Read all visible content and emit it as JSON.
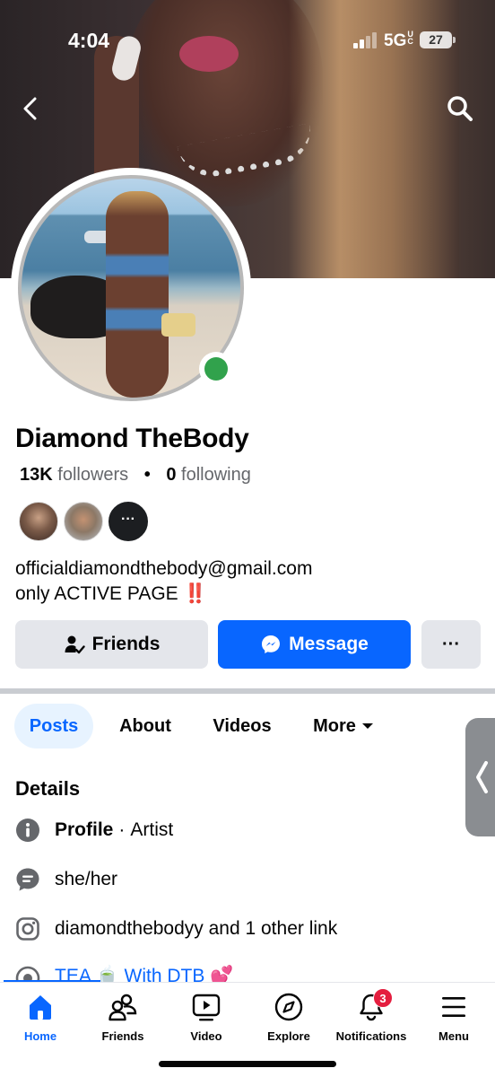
{
  "status_bar": {
    "time": "4:04",
    "network": "5G",
    "network_suffix": "UC",
    "battery": "27"
  },
  "profile": {
    "name": "Diamond TheBody",
    "followers_count": "13K",
    "followers_label": "followers",
    "separator": "•",
    "following_count": "0",
    "following_label": "following",
    "mutuals_more": "···",
    "bio_line1": "officialdiamondthebody@gmail.com",
    "bio_line2": "only ACTIVE PAGE",
    "bio_emoji": "‼️"
  },
  "actions": {
    "friends": "Friends",
    "message": "Message",
    "more": "···"
  },
  "tabs": [
    {
      "label": "Posts"
    },
    {
      "label": "About"
    },
    {
      "label": "Videos"
    },
    {
      "label": "More"
    }
  ],
  "details": {
    "title": "Details",
    "profile_label": "Profile",
    "profile_sep": "·",
    "profile_category": "Artist",
    "pronouns": "she/her",
    "links": "diamondthebodyy and 1 other link",
    "partial_row": "TEA 🍵 With DTB 💕"
  },
  "bottom_nav": {
    "items": [
      {
        "label": "Home"
      },
      {
        "label": "Friends"
      },
      {
        "label": "Video"
      },
      {
        "label": "Explore"
      },
      {
        "label": "Notifications"
      },
      {
        "label": "Menu"
      }
    ],
    "notification_count": "3"
  },
  "colors": {
    "accent": "#0866ff",
    "online": "#31a24c",
    "badge": "#e41e3f",
    "button_gray": "#e4e6eb"
  },
  "icons": [
    "back-arrow-icon",
    "search-icon",
    "friend-check-icon",
    "messenger-icon",
    "info-icon",
    "chat-bubble-icon",
    "instagram-icon",
    "home-icon",
    "friends-icon",
    "video-icon",
    "explore-icon",
    "bell-icon",
    "menu-icon"
  ]
}
